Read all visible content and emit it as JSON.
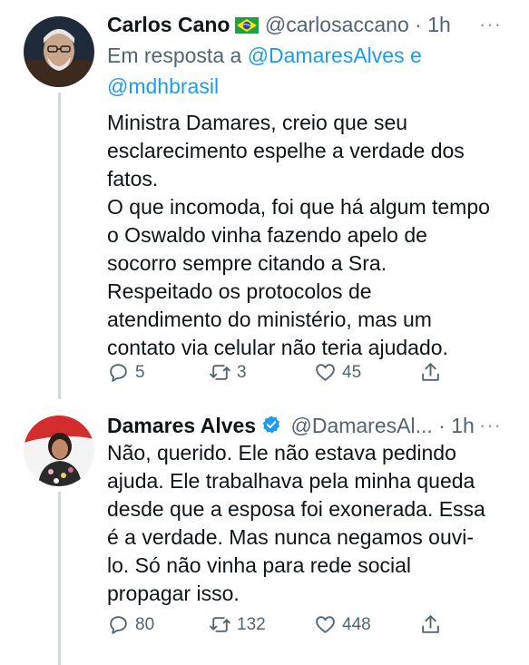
{
  "tweets": [
    {
      "name": "Carlos Cano",
      "flag_icon": "brazil-flag-icon",
      "handle": "@carlosaccano",
      "time": "· 1h",
      "reply_prefix": "Em resposta a ",
      "reply_mention_1": "@DamaresAlves",
      "reply_joiner": " e",
      "reply_mention_2": "@mdhbrasil",
      "text": "Ministra Damares, creio que seu\nesclarecimento espelhe a verdade dos\nfatos.\nO que incomoda, foi que há algum tempo\no Oswaldo vinha fazendo apelo de\nsocorro sempre citando a Sra.\nRespeitado os protocolos de\natendimento do ministério, mas um\ncontato via celular não teria ajudado.",
      "replies": "5",
      "retweets": "3",
      "likes": "45"
    },
    {
      "name": "Damares Alves",
      "verified_icon": "verified-badge-icon",
      "handle": "@DamaresAl...",
      "time": "· 1h",
      "text": "Não, querido. Ele não estava pedindo\najuda. Ele trabalhava pela minha queda\ndesde que a esposa foi exonerada. Essa\né a verdade. Mas nunca negamos ouvi-\nlo. Só não vinha para rede social\npropagar isso.",
      "replies": "80",
      "retweets": "132",
      "likes": "448"
    }
  ],
  "more_icon": "···",
  "colors": {
    "link": "#1d9bf0",
    "secondary_text": "#536471",
    "thread_line": "#cfd9de",
    "verified": "#1d9bf0"
  }
}
